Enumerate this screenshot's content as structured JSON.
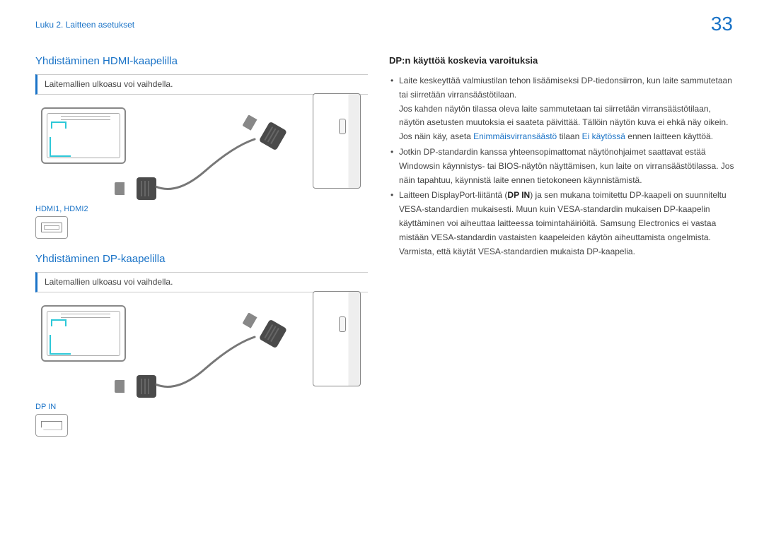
{
  "header": {
    "breadcrumb": "Luku 2. Laitteen asetukset",
    "page_number": "33"
  },
  "left": {
    "section1": {
      "title": "Yhdistäminen HDMI-kaapelilla",
      "note": "Laitemallien ulkoasu voi vaihdella.",
      "port_label": "HDMI1, HDMI2"
    },
    "section2": {
      "title": "Yhdistäminen DP-kaapelilla",
      "note": "Laitemallien ulkoasu voi vaihdella.",
      "port_label": "DP IN"
    }
  },
  "right": {
    "title": "DP:n käyttöä koskevia varoituksia",
    "bullets": [
      {
        "line1": "Laite keskeyttää valmiustilan tehon lisäämiseksi DP-tiedonsiirron, kun laite sammutetaan tai siirretään virransäästötilaan.",
        "line2": "Jos kahden näytön tilassa oleva laite sammutetaan tai siirretään virransäästötilaan, näytön asetusten muutoksia ei saateta päivittää. Tällöin näytön kuva ei ehkä näy oikein.",
        "line3_pre": "Jos näin käy, aseta ",
        "line3_link1": "Enimmäisvirransäästö",
        "line3_mid": " tilaan ",
        "line3_link2": "Ei käytössä",
        "line3_post": " ennen laitteen käyttöä."
      },
      {
        "line1": "Jotkin DP-standardin kanssa yhteensopimattomat näytönohjaimet saattavat estää Windowsin käynnistys- tai BIOS-näytön näyttämisen, kun laite on virransäästötilassa. Jos näin tapahtuu, käynnistä laite ennen tietokoneen käynnistämistä."
      },
      {
        "line1_pre": "Laitteen DisplayPort-liitäntä (",
        "line1_bold": "DP IN",
        "line1_post": ") ja sen mukana toimitettu DP-kaapeli on suunniteltu VESA-standardien mukaisesti. Muun kuin VESA-standardin mukaisen DP-kaapelin käyttäminen voi aiheuttaa laitteessa toimintahäiriöitä. Samsung Electronics ei vastaa mistään VESA-standardin vastaisten kaapeleiden käytön aiheuttamista ongelmista.",
        "line2": "Varmista, että käytät VESA-standardien mukaista DP-kaapelia."
      }
    ]
  }
}
